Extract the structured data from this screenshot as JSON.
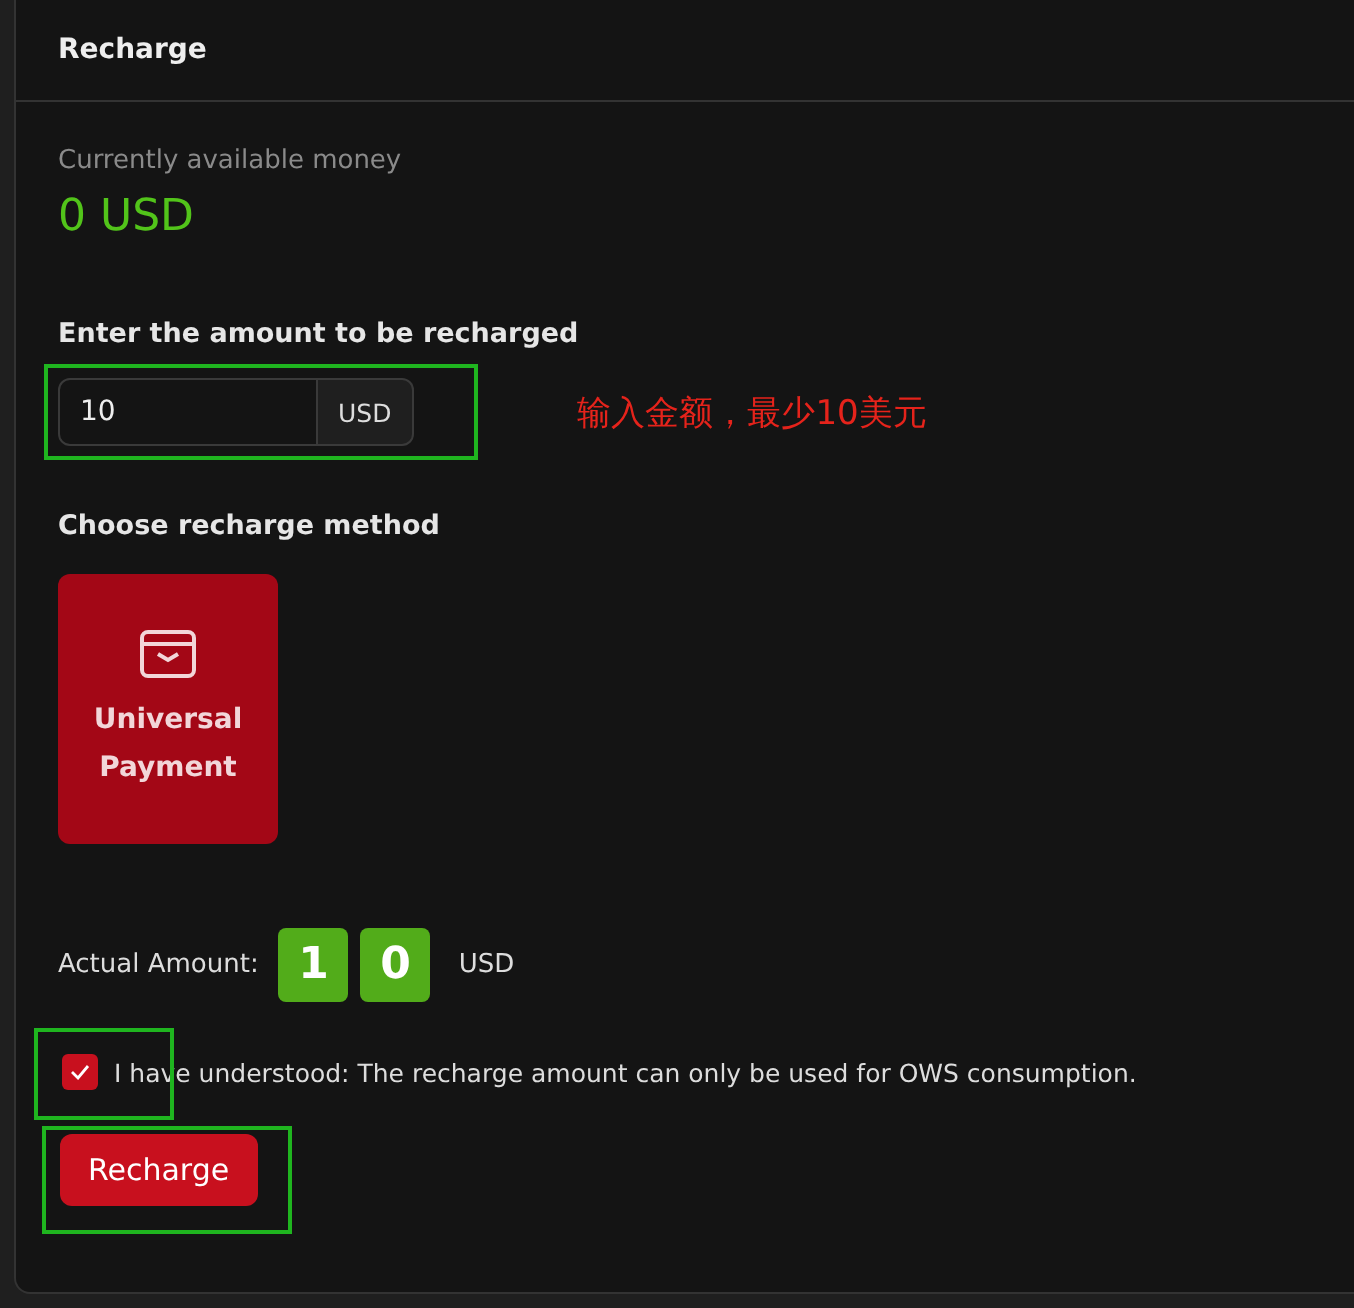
{
  "panel": {
    "title": "Recharge"
  },
  "balance": {
    "label": "Currently available money",
    "value": "0 USD"
  },
  "amount": {
    "label": "Enter the amount to be recharged",
    "value": "10",
    "unit": "USD",
    "highlighted": true,
    "note": "输入金额，最少10美元"
  },
  "method": {
    "label": "Choose recharge method",
    "options": [
      {
        "label": "Universal Payment",
        "selected": true
      }
    ]
  },
  "actual": {
    "label": "Actual Amount:",
    "digits": [
      "1",
      "0"
    ],
    "unit": "USD"
  },
  "agreement": {
    "checked": true,
    "highlighted": true,
    "text": "I have understood: The recharge amount can only be used for OWS consumption."
  },
  "submit": {
    "label": "Recharge",
    "highlighted": true
  }
}
